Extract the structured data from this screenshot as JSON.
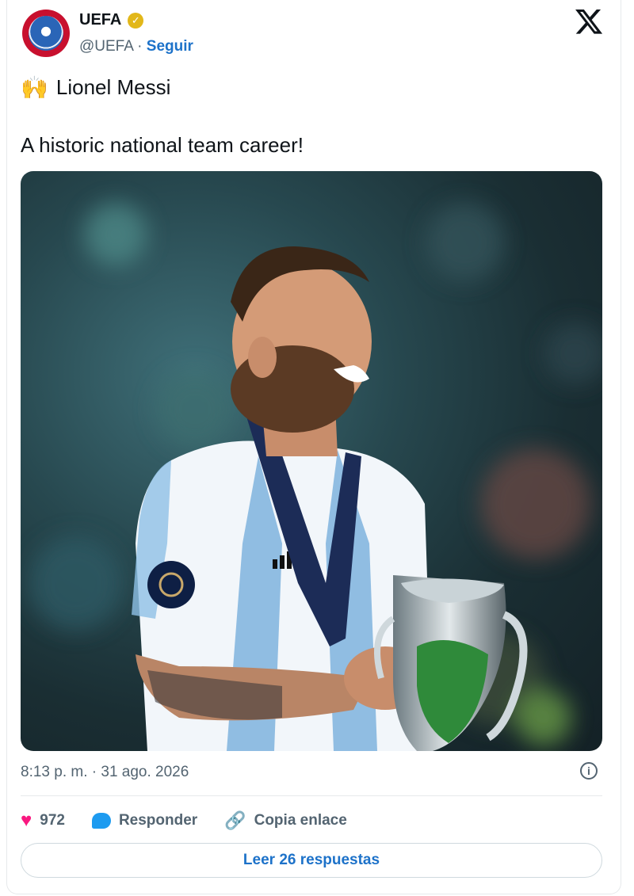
{
  "account": {
    "name": "UEFA",
    "handle": "@UEFA",
    "separator": "·",
    "follow_label": "Seguir",
    "verified_check": "✓"
  },
  "tweet": {
    "emoji": "🙌",
    "line1": "Lionel Messi",
    "line2": "A historic national team career!",
    "timestamp": "8:13 p. m. · 31 ago. 2026"
  },
  "photo": {
    "subject": "player-holding-trophy",
    "sleeve_logo": "adidas"
  },
  "actions": {
    "like_count": "972",
    "reply_label": "Responder",
    "copy_link_label": "Copia enlace"
  },
  "footer": {
    "read_replies_label": "Leer 26 respuestas"
  },
  "colors": {
    "accent_link": "#1d72c9",
    "heart": "#f91880",
    "verified": "#e2b719",
    "avatar_red": "#c8102e"
  }
}
